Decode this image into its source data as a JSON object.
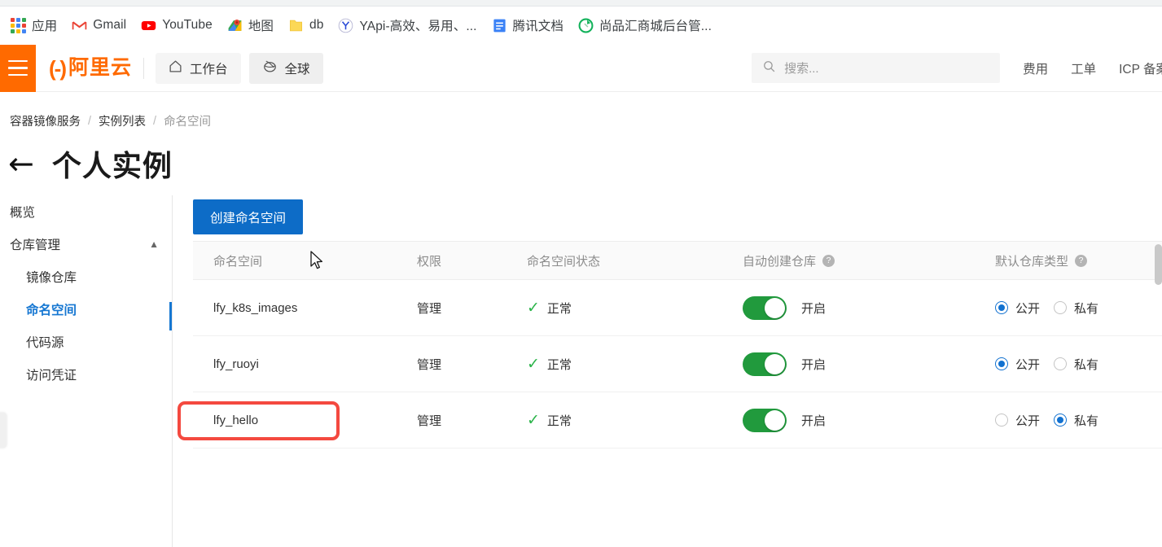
{
  "browser": {
    "bookmarks": [
      {
        "label": "应用",
        "icon": "apps-grid-icon"
      },
      {
        "label": "Gmail",
        "icon": "gmail-icon"
      },
      {
        "label": "YouTube",
        "icon": "youtube-icon"
      },
      {
        "label": "地图",
        "icon": "google-maps-icon"
      },
      {
        "label": "db",
        "icon": "folder-icon"
      },
      {
        "label": "YApi-高效、易用、...",
        "icon": "yapi-icon"
      },
      {
        "label": "腾讯文档",
        "icon": "tencent-docs-icon"
      },
      {
        "label": "尚品汇商城后台管...",
        "icon": "shangpinhui-icon"
      }
    ]
  },
  "header": {
    "menu_icon": "hamburger-menu-icon",
    "logo_mark": "(-)",
    "logo_name": "阿里云",
    "workbench": {
      "label": "工作台",
      "icon": "home-icon"
    },
    "global": {
      "label": "全球",
      "icon": "globe-icon"
    },
    "search": {
      "placeholder": "搜索...",
      "value": "",
      "icon": "search-icon"
    },
    "links": [
      "费用",
      "工单",
      "ICP 备案"
    ]
  },
  "breadcrumb": {
    "items": [
      "容器镜像服务",
      "实例列表",
      "命名空间"
    ],
    "separator": "/"
  },
  "page": {
    "back_icon": "back-arrow-icon",
    "title": "个人实例"
  },
  "sidebar": {
    "items": [
      {
        "label": "概览",
        "level": 0,
        "active": false,
        "expandable": false
      },
      {
        "label": "仓库管理",
        "level": 0,
        "active": false,
        "expandable": true,
        "chevron": "▲"
      },
      {
        "label": "镜像仓库",
        "level": 1,
        "active": false,
        "expandable": false
      },
      {
        "label": "命名空间",
        "level": 1,
        "active": true,
        "expandable": false
      },
      {
        "label": "代码源",
        "level": 1,
        "active": false,
        "expandable": false
      },
      {
        "label": "访问凭证",
        "level": 1,
        "active": false,
        "expandable": false
      }
    ],
    "accent_color": "#1677d2"
  },
  "toolbar": {
    "create_label": "创建命名空间"
  },
  "table": {
    "columns": [
      {
        "key": "name",
        "label": "命名空间",
        "help": false
      },
      {
        "key": "perm",
        "label": "权限",
        "help": false
      },
      {
        "key": "state",
        "label": "命名空间状态",
        "help": false
      },
      {
        "key": "auto",
        "label": "自动创建仓库",
        "help": true,
        "help_icon": "question-mark-icon"
      },
      {
        "key": "type",
        "label": "默认仓库类型",
        "help": true,
        "help_icon": "question-mark-icon"
      }
    ],
    "rows": [
      {
        "name": "lfy_k8s_images",
        "perm": "管理",
        "state": "正常",
        "state_icon": "check-icon",
        "auto_on": true,
        "auto_label": "开启",
        "type_options": [
          {
            "label": "公开",
            "selected": true
          },
          {
            "label": "私有",
            "selected": false
          }
        ],
        "highlighted": false
      },
      {
        "name": "lfy_ruoyi",
        "perm": "管理",
        "state": "正常",
        "state_icon": "check-icon",
        "auto_on": true,
        "auto_label": "开启",
        "type_options": [
          {
            "label": "公开",
            "selected": true
          },
          {
            "label": "私有",
            "selected": false
          }
        ],
        "highlighted": false
      },
      {
        "name": "lfy_hello",
        "perm": "管理",
        "state": "正常",
        "state_icon": "check-icon",
        "auto_on": true,
        "auto_label": "开启",
        "type_options": [
          {
            "label": "公开",
            "selected": false
          },
          {
            "label": "私有",
            "selected": true
          }
        ],
        "highlighted": true
      }
    ]
  },
  "annotation": {
    "highlight_color": "#f4493f",
    "target_row": "lfy_hello"
  },
  "colors": {
    "brand_orange": "#ff6a00",
    "primary_blue": "#0d6cc7",
    "accent_blue": "#1677d2",
    "toggle_green": "#219a3d",
    "status_green": "#2bb44a",
    "annotation_red": "#f4493f"
  }
}
